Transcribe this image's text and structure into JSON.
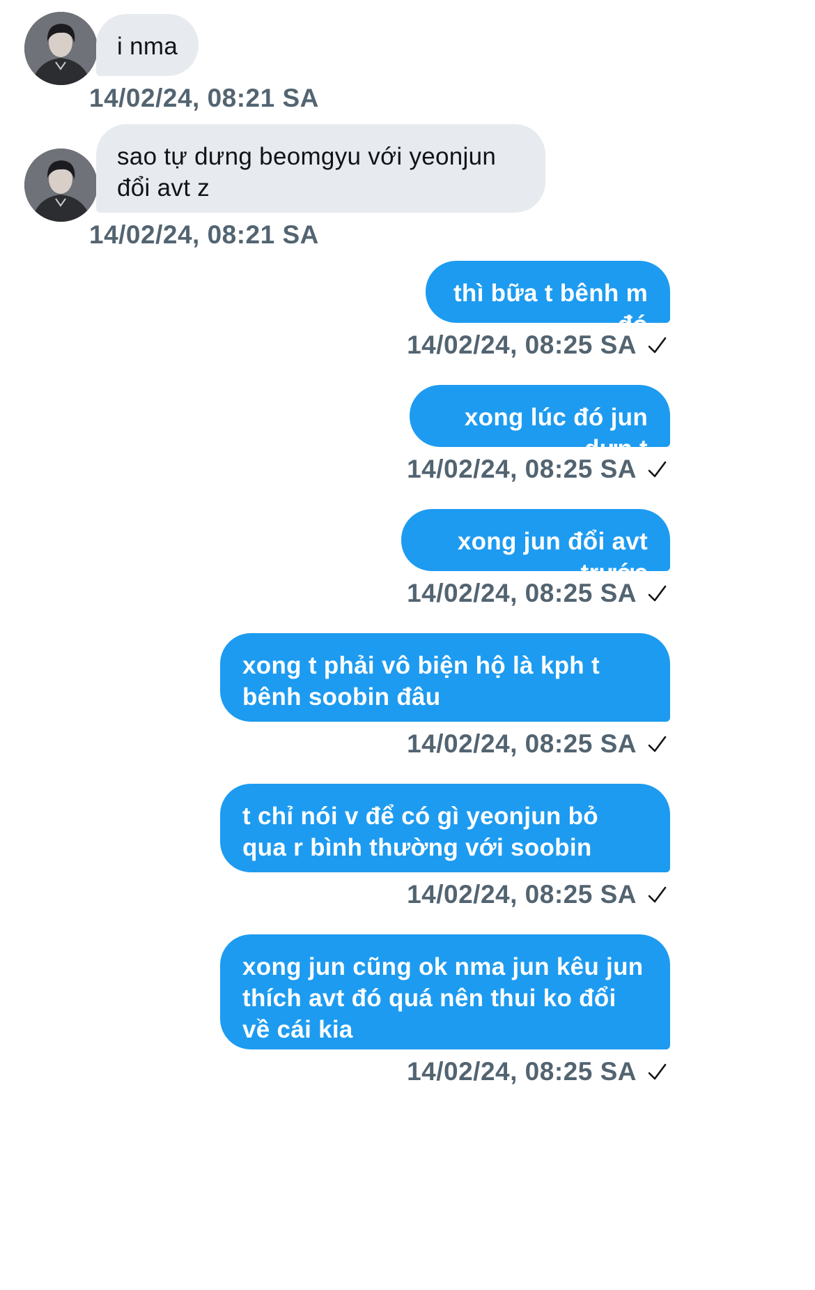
{
  "conversation": {
    "incoming": [
      {
        "text": "i nma",
        "timestamp": "14/02/24, 08:21 SA"
      },
      {
        "text": "sao tự dưng beomgyu với yeonjun đổi avt z",
        "timestamp": "14/02/24, 08:21 SA"
      }
    ],
    "outgoing": [
      {
        "text": "thì bữa t bênh m đó",
        "timestamp": "14/02/24, 08:25 SA",
        "status": "sent-check-icon"
      },
      {
        "text": "xong lúc đó jun dựn t",
        "timestamp": "14/02/24, 08:25 SA",
        "status": "sent-check-icon"
      },
      {
        "text": "xong jun đổi avt trước",
        "timestamp": "14/02/24, 08:25 SA",
        "status": "sent-check-icon"
      },
      {
        "text": "xong t phải vô biện hộ là kph t bênh soobin đâu",
        "timestamp": "14/02/24, 08:25 SA",
        "status": "sent-check-icon"
      },
      {
        "text": "t chỉ nói v để có gì yeonjun bỏ qua r bình thường với soobin",
        "timestamp": "14/02/24, 08:25 SA",
        "status": "sent-check-icon"
      },
      {
        "text": "xong jun cũng ok nma jun kêu jun thích avt đó quá nên thui ko đổi về cái kia",
        "timestamp": "14/02/24, 08:25 SA",
        "status": "sent-check-icon"
      }
    ]
  },
  "colors": {
    "outgoing_bubble": "#1d9bf0",
    "incoming_bubble": "#e7ebef",
    "timestamp": "#536471",
    "incoming_text": "#0f1419"
  },
  "icons": {
    "avatar": "user-avatar-photo",
    "status": "check-icon"
  }
}
